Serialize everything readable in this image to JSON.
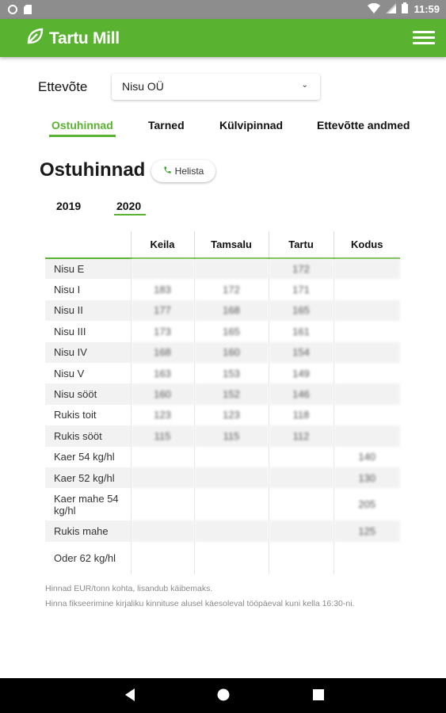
{
  "status_bar": {
    "time": "11:59",
    "icons": [
      "circle-notification-icon",
      "sd-card-icon",
      "wifi-icon",
      "signal-icon",
      "battery-icon"
    ]
  },
  "app_bar": {
    "logo_text": "Tartu Mill",
    "menu_icon": "hamburger-menu-icon",
    "color": "#59b330"
  },
  "company": {
    "label": "Ettevõte",
    "selected": "Nisu OÜ"
  },
  "tabs": [
    {
      "label": "Ostuhinnad",
      "active": true
    },
    {
      "label": "Tarned",
      "active": false
    },
    {
      "label": "Külvipinnad",
      "active": false
    },
    {
      "label": "Ettevõtte andmed",
      "active": false
    }
  ],
  "page": {
    "title": "Ostuhinnad",
    "call_button": "Helista"
  },
  "years": [
    {
      "label": "2019",
      "active": false
    },
    {
      "label": "2020",
      "active": true
    }
  ],
  "table": {
    "headers": [
      "",
      "Keila",
      "Tamsalu",
      "Tartu",
      "Kodus"
    ],
    "rows": [
      {
        "name": "Nisu E",
        "keila": "",
        "tamsalu": "",
        "tartu": "172",
        "kodus": ""
      },
      {
        "name": "Nisu I",
        "keila": "183",
        "tamsalu": "172",
        "tartu": "171",
        "kodus": ""
      },
      {
        "name": "Nisu II",
        "keila": "177",
        "tamsalu": "168",
        "tartu": "165",
        "kodus": ""
      },
      {
        "name": "Nisu III",
        "keila": "173",
        "tamsalu": "165",
        "tartu": "161",
        "kodus": ""
      },
      {
        "name": "Nisu IV",
        "keila": "168",
        "tamsalu": "160",
        "tartu": "154",
        "kodus": ""
      },
      {
        "name": "Nisu V",
        "keila": "163",
        "tamsalu": "153",
        "tartu": "149",
        "kodus": ""
      },
      {
        "name": "Nisu sööt",
        "keila": "160",
        "tamsalu": "152",
        "tartu": "146",
        "kodus": ""
      },
      {
        "name": "Rukis toit",
        "keila": "123",
        "tamsalu": "123",
        "tartu": "118",
        "kodus": ""
      },
      {
        "name": "Rukis sööt",
        "keila": "115",
        "tamsalu": "115",
        "tartu": "112",
        "kodus": ""
      },
      {
        "name": "Kaer 54 kg/hl",
        "keila": "",
        "tamsalu": "",
        "tartu": "",
        "kodus": "140"
      },
      {
        "name": "Kaer 52 kg/hl",
        "keila": "",
        "tamsalu": "",
        "tartu": "",
        "kodus": "130"
      },
      {
        "name": "Kaer mahe 54 kg/hl",
        "keila": "",
        "tamsalu": "",
        "tartu": "",
        "kodus": "205"
      },
      {
        "name": "Rukis mahe",
        "keila": "",
        "tamsalu": "",
        "tartu": "",
        "kodus": "125"
      },
      {
        "name": "Oder 62 kg/hl",
        "keila": "",
        "tamsalu": "",
        "tartu": "",
        "kodus": ""
      }
    ]
  },
  "notes": [
    "Hinnad EUR/tonn kohta, lisandub käibemaks.",
    "Hinna fikseerimine kirjaliku kinnituse alusel käesoleval tööpäeval kuni kella 16:30-ni."
  ],
  "nav_bar": {
    "icons": [
      "back-icon",
      "home-icon",
      "recents-icon"
    ]
  }
}
